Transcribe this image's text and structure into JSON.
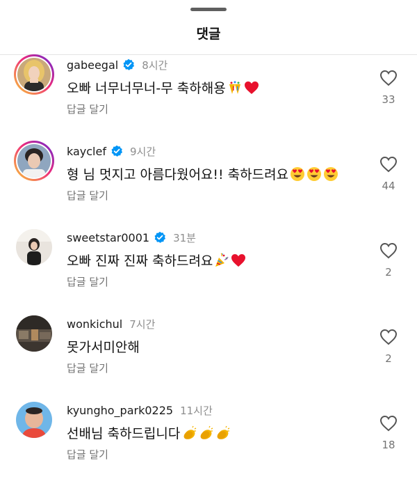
{
  "header": {
    "title": "댓글"
  },
  "comments": [
    {
      "username": "gabeegal",
      "verified": true,
      "time": "8시간",
      "text": "오빠 너무너무너-무 축하해용",
      "emoji": [
        "confetti-ball-emoji",
        "red-heart-emoji"
      ],
      "reply_label": "답글 달기",
      "likes": "33"
    },
    {
      "username": "kayclef",
      "verified": true,
      "time": "9시간",
      "text": "형 님 멋지고 아름다웠어요!! 축하드려요",
      "emoji": [
        "heart-eyes-emoji",
        "heart-eyes-emoji",
        "heart-eyes-emoji"
      ],
      "reply_label": "답글 달기",
      "likes": "44"
    },
    {
      "username": "sweetstar0001",
      "verified": true,
      "time": "31분",
      "text": "오빠 진짜 진짜 축하드려요",
      "emoji": [
        "party-popper-emoji",
        "red-heart-emoji"
      ],
      "reply_label": "답글 달기",
      "likes": "2"
    },
    {
      "username": "wonkichul",
      "verified": false,
      "time": "7시간",
      "text": "못가서미안해",
      "emoji": [],
      "reply_label": "답글 달기",
      "likes": "2"
    },
    {
      "username": "kyungho_park0225",
      "verified": false,
      "time": "11시간",
      "text": "선배님 축하드립니다",
      "emoji": [
        "clapping-hands-emoji",
        "clapping-hands-emoji",
        "clapping-hands-emoji"
      ],
      "reply_label": "답글 달기",
      "likes": "18"
    }
  ],
  "colors": {
    "verified_badge": "#0095f6",
    "heart_emoji": "#e8112d",
    "secondary_text": "#737373",
    "story_ring_start": "#f9ce34",
    "story_ring_end": "#6228d7"
  }
}
